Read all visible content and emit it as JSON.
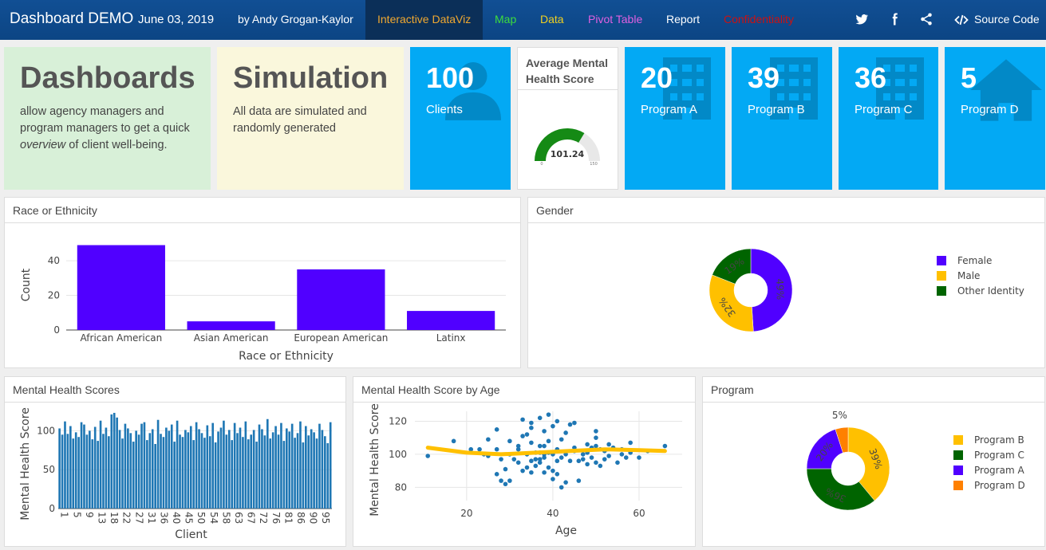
{
  "navbar": {
    "brand": "Dashboard DEMO",
    "date": "June 03, 2019",
    "author": "by Andy Grogan-Kaylor",
    "tabs": [
      {
        "label": "Interactive DataViz",
        "color": "#f0a830",
        "active": true
      },
      {
        "label": "Map",
        "color": "#3ddc3d"
      },
      {
        "label": "Data",
        "color": "#f0d020"
      },
      {
        "label": "Pivot Table",
        "color": "#e060e0"
      },
      {
        "label": "Report",
        "color": "#ffffff"
      },
      {
        "label": "Confidentiality",
        "color": "#cc1111"
      }
    ],
    "social_icons": [
      "twitter-icon",
      "facebook-icon",
      "share-icon"
    ],
    "source_code_label": "Source Code"
  },
  "intro": {
    "dashboards_title": "Dashboards",
    "dashboards_text_1": "allow agency managers and program managers to get a quick",
    "dashboards_text_em": "overview",
    "dashboards_text_2": "of client well-being.",
    "simulation_title": "Simulation",
    "simulation_text": "All data are simulated and randomly generated"
  },
  "value_boxes": [
    {
      "value": "100",
      "caption": "Clients",
      "icon": "user-icon"
    },
    {
      "value": "20",
      "caption": "Program A",
      "icon": "building-icon"
    },
    {
      "value": "39",
      "caption": "Program B",
      "icon": "building-icon"
    },
    {
      "value": "36",
      "caption": "Program C",
      "icon": "building-icon"
    },
    {
      "value": "5",
      "caption": "Program D",
      "icon": "home-icon"
    }
  ],
  "gauge": {
    "title": "Average Mental Health Score",
    "value": "101.24",
    "min": "0",
    "max": "150",
    "value_num": 101.24,
    "max_num": 150
  },
  "colors": {
    "accent_blue": "#03a9f4",
    "purple": "#5000ff",
    "gold": "#ffc000",
    "green": "#006400",
    "orange": "#ff8000",
    "bar_blue": "#1f77b4"
  },
  "race_panel": {
    "title": "Race or Ethnicity"
  },
  "gender_panel": {
    "title": "Gender"
  },
  "scores_panel": {
    "title": "Mental Health Scores"
  },
  "age_panel": {
    "title": "Mental Health Score by Age"
  },
  "program_panel": {
    "title": "Program"
  },
  "chart_data": [
    {
      "type": "bar",
      "categories": [
        "African American",
        "Asian American",
        "European American",
        "Latinx"
      ],
      "values": [
        49,
        5,
        35,
        11
      ],
      "xlabel": "Race or Ethnicity",
      "ylabel": "Count",
      "yticks": [
        0,
        20,
        40
      ],
      "ylim": [
        0,
        52
      ]
    },
    {
      "type": "pie",
      "hole": true,
      "labels": [
        "Female",
        "Male",
        "Other Identity"
      ],
      "values": [
        49,
        32,
        19
      ],
      "slice_labels": [
        "49%",
        "32%",
        "19%"
      ],
      "colors": [
        "#5000ff",
        "#ffc000",
        "#006400"
      ],
      "legend_position": "right"
    },
    {
      "type": "bar",
      "xlabel": "Client",
      "ylabel": "Mental Health Score",
      "yticks": [
        0,
        50,
        100
      ],
      "ylim": [
        0,
        125
      ],
      "xtick_labels": [
        "1",
        "5",
        "9",
        "13",
        "18",
        "22",
        "27",
        "31",
        "36",
        "40",
        "45",
        "50",
        "54",
        "58",
        "63",
        "67",
        "72",
        "76",
        "81",
        "86",
        "90",
        "95"
      ],
      "values": [
        103,
        95,
        112,
        96,
        106,
        90,
        98,
        92,
        111,
        108,
        95,
        100,
        89,
        105,
        87,
        113,
        96,
        104,
        93,
        121,
        123,
        117,
        101,
        90,
        109,
        103,
        97,
        86,
        100,
        95,
        109,
        111,
        88,
        97,
        102,
        83,
        114,
        96,
        92,
        104,
        100,
        108,
        86,
        113,
        95,
        92,
        101,
        98,
        106,
        88,
        111,
        102,
        97,
        91,
        107,
        93,
        110,
        85,
        99,
        104,
        113,
        95,
        101,
        88,
        110,
        97,
        104,
        92,
        112,
        89,
        95,
        101,
        86,
        108,
        102,
        94,
        115,
        90,
        98,
        106,
        95,
        110,
        87,
        103,
        99,
        109,
        91,
        97,
        112,
        85,
        106,
        94,
        102,
        98,
        90,
        109,
        101,
        93,
        84,
        111
      ]
    },
    {
      "type": "scatter",
      "xlabel": "Age",
      "ylabel": "Mental Health Score",
      "xticks": [
        20,
        40,
        60
      ],
      "yticks": [
        80,
        100,
        120
      ],
      "xlim": [
        8,
        70
      ],
      "ylim": [
        72,
        126
      ],
      "points": [
        [
          11,
          99
        ],
        [
          17,
          108
        ],
        [
          21,
          103
        ],
        [
          23,
          103
        ],
        [
          24,
          100
        ],
        [
          25,
          99
        ],
        [
          25,
          109
        ],
        [
          27,
          103
        ],
        [
          27,
          115
        ],
        [
          27,
          88
        ],
        [
          28,
          97
        ],
        [
          28,
          84
        ],
        [
          29,
          91
        ],
        [
          29,
          82
        ],
        [
          30,
          84
        ],
        [
          30,
          108
        ],
        [
          30,
          100
        ],
        [
          31,
          97
        ],
        [
          32,
          105
        ],
        [
          32,
          95
        ],
        [
          32,
          103
        ],
        [
          33,
          121
        ],
        [
          33,
          90
        ],
        [
          33,
          111
        ],
        [
          34,
          92
        ],
        [
          34,
          112
        ],
        [
          34,
          100
        ],
        [
          35,
          96
        ],
        [
          35,
          107
        ],
        [
          35,
          119
        ],
        [
          35,
          116
        ],
        [
          35,
          89
        ],
        [
          36,
          101
        ],
        [
          36,
          97
        ],
        [
          36,
          93
        ],
        [
          37,
          105
        ],
        [
          37,
          101
        ],
        [
          37,
          97
        ],
        [
          37,
          122
        ],
        [
          37,
          95
        ],
        [
          38,
          89
        ],
        [
          38,
          100
        ],
        [
          38,
          114
        ],
        [
          38,
          98
        ],
        [
          38,
          105
        ],
        [
          39,
          124
        ],
        [
          39,
          92
        ],
        [
          39,
          108
        ],
        [
          39,
          101
        ],
        [
          40,
          117
        ],
        [
          40,
          90
        ],
        [
          40,
          100
        ],
        [
          40,
          85
        ],
        [
          41,
          103
        ],
        [
          41,
          96
        ],
        [
          41,
          120
        ],
        [
          41,
          88
        ],
        [
          42,
          80
        ],
        [
          42,
          98
        ],
        [
          42,
          109
        ],
        [
          43,
          83
        ],
        [
          43,
          113
        ],
        [
          43,
          100
        ],
        [
          44,
          118
        ],
        [
          44,
          96
        ],
        [
          45,
          104
        ],
        [
          45,
          102
        ],
        [
          45,
          119
        ],
        [
          46,
          96
        ],
        [
          46,
          84
        ],
        [
          47,
          97
        ],
        [
          47,
          100
        ],
        [
          48,
          106
        ],
        [
          48,
          101
        ],
        [
          48,
          94
        ],
        [
          49,
          104
        ],
        [
          49,
          98
        ],
        [
          50,
          95
        ],
        [
          50,
          114
        ],
        [
          50,
          105
        ],
        [
          50,
          110
        ],
        [
          51,
          103
        ],
        [
          51,
          93
        ],
        [
          52,
          102
        ],
        [
          52,
          97
        ],
        [
          53,
          99
        ],
        [
          53,
          106
        ],
        [
          54,
          104
        ],
        [
          55,
          95
        ],
        [
          56,
          103
        ],
        [
          56,
          100
        ],
        [
          57,
          98
        ],
        [
          58,
          107
        ],
        [
          58,
          101
        ],
        [
          60,
          98
        ],
        [
          62,
          102
        ],
        [
          66,
          105
        ]
      ],
      "smooth": [
        [
          11,
          104
        ],
        [
          20,
          101
        ],
        [
          28,
          100
        ],
        [
          36,
          101
        ],
        [
          44,
          102
        ],
        [
          52,
          103
        ],
        [
          60,
          102.5
        ],
        [
          66,
          102
        ]
      ],
      "smooth_color": "#ffc000"
    },
    {
      "type": "pie",
      "hole": true,
      "labels": [
        "Program B",
        "Program C",
        "Program A",
        "Program D"
      ],
      "values": [
        39,
        36,
        20,
        5
      ],
      "slice_labels": [
        "39%",
        "36%",
        "20%",
        "5%"
      ],
      "colors": [
        "#ffc000",
        "#006400",
        "#5000ff",
        "#ff8000"
      ],
      "legend_position": "right"
    }
  ]
}
